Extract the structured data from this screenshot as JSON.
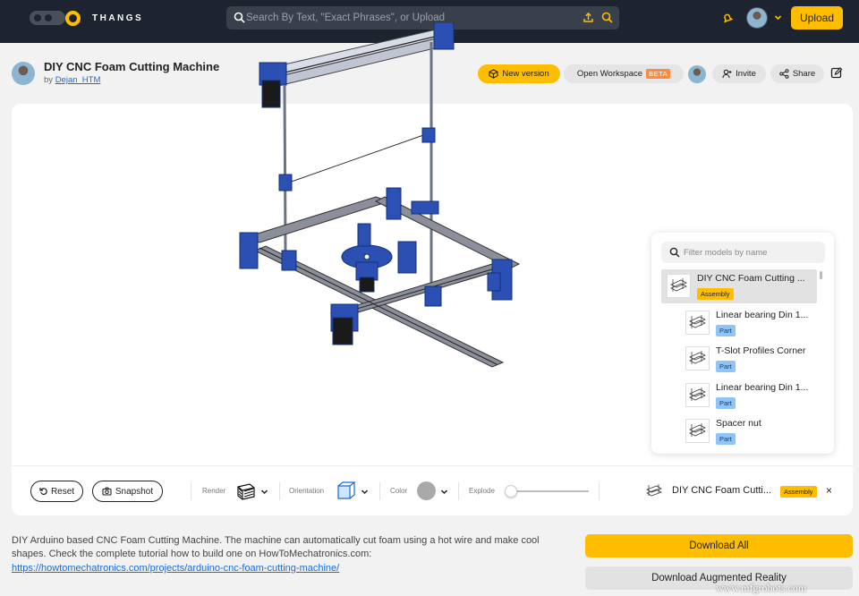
{
  "app": {
    "name": "THANGS",
    "search_placeholder": "Search By Text, \"Exact Phrases\", or Upload",
    "upload_label": "Upload"
  },
  "model": {
    "title": "DIY CNC Foam Cutting Machine",
    "by_prefix": "by",
    "author": "Dejan_HTM"
  },
  "actions": {
    "new_version": "New version",
    "open_workspace": "Open Workspace",
    "beta": "BETA",
    "invite": "Invite",
    "share": "Share"
  },
  "model_panel": {
    "filter_placeholder": "Filter models by name",
    "items": [
      {
        "name": "DIY CNC Foam Cutting ...",
        "badge": "Assembly"
      },
      {
        "name": "Linear bearing Din 1...",
        "badge": "Part"
      },
      {
        "name": "T-Slot Profiles Corner",
        "badge": "Part"
      },
      {
        "name": "Linear bearing Din 1...",
        "badge": "Part"
      },
      {
        "name": "Spacer nut",
        "badge": "Part"
      }
    ]
  },
  "toolbar": {
    "reset": "Reset",
    "snapshot": "Snapshot",
    "render": "Render",
    "orientation": "Orientation",
    "color": "Color",
    "explode": "Explode",
    "explode_level": 0,
    "selected_name": "DIY CNC Foam Cutti...",
    "selected_badge": "Assembly",
    "close": "×"
  },
  "description": {
    "text": "DIY Arduino based CNC Foam Cutting Machine. The machine can automatically cut foam using a hot wire and make cool shapes. Check the complete tutorial how to build one on HowToMechatronics.com:",
    "link": "https://howtomechatronics.com/projects/arduino-cnc-foam-cutting-machine/"
  },
  "downloads": {
    "all": "Download All",
    "ar": "Download Augmented Reality"
  },
  "watermark": "www.mfgrobots.com",
  "colors": {
    "accent": "#ffbd00",
    "nav_bg": "#1e2330",
    "part_badge": "#8ec4f7",
    "model_blue": "#2b4fb3"
  }
}
